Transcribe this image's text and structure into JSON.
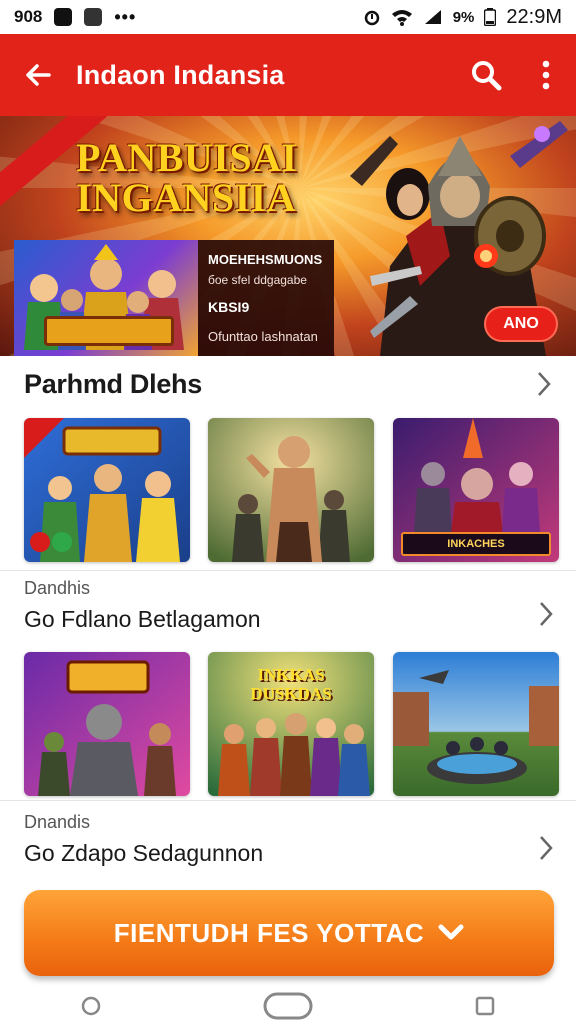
{
  "status_bar": {
    "left_text": "908",
    "right_text": "9%",
    "time": "22:9M"
  },
  "app_bar": {
    "title": "Indaon Indansia"
  },
  "hero": {
    "ribbon": "",
    "title_line1": "PANBUISAI",
    "title_line2": "INGANSIIA",
    "card_line1": "MOEHEHSMUONS",
    "card_line2": "бое sfel ddgagabe",
    "card_line3": "KBSI9",
    "card_line4": "Ofunttao lashnatan",
    "thumb_banner": "",
    "button_label": "ANO"
  },
  "section1": {
    "title": "Parhmd Dlehs"
  },
  "row1_tiles": [
    {
      "label": "",
      "colors": [
        "#2f6ed8",
        "#e8b92a"
      ]
    },
    {
      "label": "",
      "colors": [
        "#6b8b46",
        "#e6c36a"
      ]
    },
    {
      "label": "INKACHES",
      "colors": [
        "#3a1c6e",
        "#d23a7a"
      ]
    }
  ],
  "section2": {
    "subtitle": "Dandhis",
    "name": "Go Fdlano Betlagamon"
  },
  "row2_tiles": [
    {
      "label": "",
      "colors": [
        "#6a2aa8",
        "#e04aa0"
      ]
    },
    {
      "label": "INKKAS DUSKDAS",
      "colors": [
        "#2a6b3a",
        "#f0c23a"
      ]
    },
    {
      "label": "",
      "colors": [
        "#2d7ed6",
        "#7fc25a"
      ]
    }
  ],
  "section3": {
    "subtitle": "Dnandis",
    "name": "Go Zdapo Sedagunnon"
  },
  "cta": {
    "label": "FIENTUDH FES YOTTAC"
  },
  "colors": {
    "primary_red": "#e2231a",
    "cta_orange": "#f47a16"
  }
}
